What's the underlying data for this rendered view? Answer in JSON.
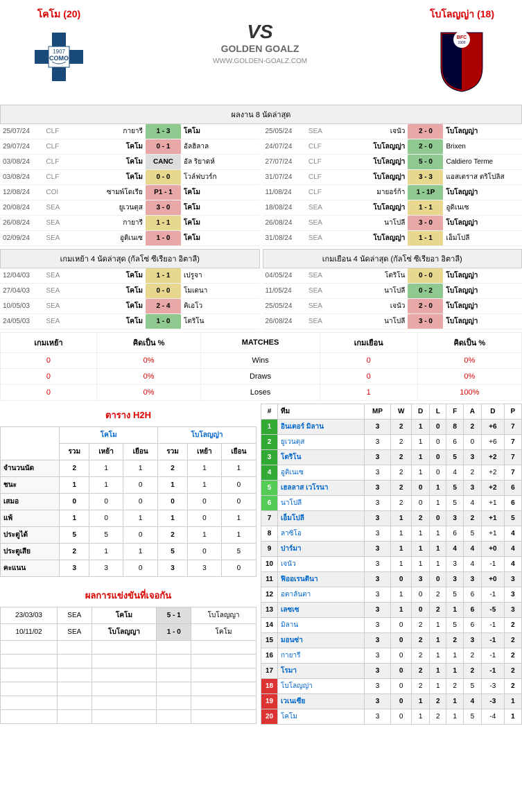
{
  "header": {
    "home": "โคโม (20)",
    "away": "โบโลญญ่า (18)",
    "vs": "VS",
    "site": "GOLDEN GOALZ",
    "site_sub": "WWW.GOLDEN-GOALZ.COM"
  },
  "last8_title": "ผลงาน 8 นัดล่าสุด",
  "last8_home": [
    {
      "date": "25/07/24",
      "comp": "CLF",
      "h": "กายารี",
      "s": "1 - 3",
      "a": "โคโม",
      "c": "sc-green",
      "hb": false,
      "ab": true
    },
    {
      "date": "29/07/24",
      "comp": "CLF",
      "h": "โคโม",
      "s": "0 - 1",
      "a": "อัลฮิลาล",
      "c": "sc-red",
      "hb": true,
      "ab": false
    },
    {
      "date": "03/08/24",
      "comp": "CLF",
      "h": "โคโม",
      "s": "CANC",
      "a": "อัล ริยาดห์",
      "c": "sc-gray",
      "hb": true,
      "ab": false
    },
    {
      "date": "03/08/24",
      "comp": "CLF",
      "h": "โคโม",
      "s": "0 - 0",
      "a": "โวล์ฟบวร์ก",
      "c": "sc-yellow",
      "hb": true,
      "ab": false
    },
    {
      "date": "12/08/24",
      "comp": "COI",
      "h": "ซามพ์โดเรีย",
      "s": "P1 - 1",
      "a": "โคโม",
      "c": "sc-red",
      "hb": false,
      "ab": true
    },
    {
      "date": "20/08/24",
      "comp": "SEA",
      "h": "ยูเวนตุส",
      "s": "3 - 0",
      "a": "โคโม",
      "c": "sc-red",
      "hb": false,
      "ab": true
    },
    {
      "date": "26/08/24",
      "comp": "SEA",
      "h": "กายารี",
      "s": "1 - 1",
      "a": "โคโม",
      "c": "sc-yellow",
      "hb": false,
      "ab": true
    },
    {
      "date": "02/09/24",
      "comp": "SEA",
      "h": "อูดิเนเซ",
      "s": "1 - 0",
      "a": "โคโม",
      "c": "sc-red",
      "hb": false,
      "ab": true
    }
  ],
  "last8_away": [
    {
      "date": "25/05/24",
      "comp": "SEA",
      "h": "เจนัว",
      "s": "2 - 0",
      "a": "โบโลญญ่า",
      "c": "sc-red",
      "hb": false,
      "ab": true
    },
    {
      "date": "24/07/24",
      "comp": "CLF",
      "h": "โบโลญญ่า",
      "s": "2 - 0",
      "a": "Brixen",
      "c": "sc-green",
      "hb": true,
      "ab": false
    },
    {
      "date": "27/07/24",
      "comp": "CLF",
      "h": "โบโลญญ่า",
      "s": "5 - 0",
      "a": "Caldiero Terme",
      "c": "sc-green",
      "hb": true,
      "ab": false
    },
    {
      "date": "31/07/24",
      "comp": "CLF",
      "h": "โบโลญญ่า",
      "s": "3 - 3",
      "a": "แอสเตราส ตริโปลิส",
      "c": "sc-yellow",
      "hb": true,
      "ab": false
    },
    {
      "date": "11/08/24",
      "comp": "CLF",
      "h": "มายอร์ก้า",
      "s": "1 - 1P",
      "a": "โบโลญญ่า",
      "c": "sc-green",
      "hb": false,
      "ab": true
    },
    {
      "date": "18/08/24",
      "comp": "SEA",
      "h": "โบโลญญ่า",
      "s": "1 - 1",
      "a": "อูดิเนเซ",
      "c": "sc-yellow",
      "hb": true,
      "ab": false
    },
    {
      "date": "26/08/24",
      "comp": "SEA",
      "h": "นาโปลี",
      "s": "3 - 0",
      "a": "โบโลญญ่า",
      "c": "sc-red",
      "hb": false,
      "ab": true
    },
    {
      "date": "31/08/24",
      "comp": "SEA",
      "h": "โบโลญญ่า",
      "s": "1 - 1",
      "a": "เอ็มโปลี",
      "c": "sc-yellow",
      "hb": true,
      "ab": false
    }
  ],
  "home4_title": "เกมเหย้า 4 นัดล่าสุด (กัลโซ่ ซีเรียอา อิตาลี)",
  "away4_title": "เกมเยือน 4 นัดล่าสุด (กัลโซ่ ซีเรียอา อิตาลี)",
  "home4": [
    {
      "date": "12/04/03",
      "comp": "SEA",
      "h": "โคโม",
      "s": "1 - 1",
      "a": "เปรูจา",
      "c": "sc-yellow",
      "hb": true,
      "ab": false
    },
    {
      "date": "27/04/03",
      "comp": "SEA",
      "h": "โคโม",
      "s": "0 - 0",
      "a": "โมเดนา",
      "c": "sc-yellow",
      "hb": true,
      "ab": false
    },
    {
      "date": "10/05/03",
      "comp": "SEA",
      "h": "โคโม",
      "s": "2 - 4",
      "a": "คิเอโว",
      "c": "sc-red",
      "hb": true,
      "ab": false
    },
    {
      "date": "24/05/03",
      "comp": "SEA",
      "h": "โคโม",
      "s": "1 - 0",
      "a": "โตริโน",
      "c": "sc-green",
      "hb": true,
      "ab": false
    }
  ],
  "away4": [
    {
      "date": "04/05/24",
      "comp": "SEA",
      "h": "โตริโน",
      "s": "0 - 0",
      "a": "โบโลญญ่า",
      "c": "sc-yellow",
      "hb": false,
      "ab": true
    },
    {
      "date": "11/05/24",
      "comp": "SEA",
      "h": "นาโปลี",
      "s": "0 - 2",
      "a": "โบโลญญ่า",
      "c": "sc-green",
      "hb": false,
      "ab": true
    },
    {
      "date": "25/05/24",
      "comp": "SEA",
      "h": "เจนัว",
      "s": "2 - 0",
      "a": "โบโลญญ่า",
      "c": "sc-red",
      "hb": false,
      "ab": true
    },
    {
      "date": "26/08/24",
      "comp": "SEA",
      "h": "นาโปลี",
      "s": "3 - 0",
      "a": "โบโลญญ่า",
      "c": "sc-red",
      "hb": false,
      "ab": true
    }
  ],
  "summary": {
    "headers": [
      "เกมเหย้า",
      "คิดเป็น %",
      "MATCHES",
      "เกมเยือน",
      "คิดเป็น %"
    ],
    "rows": [
      [
        "0",
        "0%",
        "Wins",
        "0",
        "0%"
      ],
      [
        "0",
        "0%",
        "Draws",
        "0",
        "0%"
      ],
      [
        "0",
        "0%",
        "Loses",
        "1",
        "100%"
      ]
    ]
  },
  "h2h": {
    "title": "ตาราง H2H",
    "teams": [
      "โคโม",
      "โบโลญญ่า"
    ],
    "cols": [
      "รวม",
      "เหย้า",
      "เยือน",
      "รวม",
      "เหย้า",
      "เยือน"
    ],
    "rows": [
      {
        "lbl": "จำนวนนัด",
        "v": [
          "2",
          "1",
          "1",
          "2",
          "1",
          "1"
        ],
        "b": [
          0,
          3
        ]
      },
      {
        "lbl": "ชนะ",
        "v": [
          "1",
          "1",
          "0",
          "1",
          "1",
          "0"
        ],
        "b": [
          0,
          3
        ]
      },
      {
        "lbl": "เสมอ",
        "v": [
          "0",
          "0",
          "0",
          "0",
          "0",
          "0"
        ],
        "b": [
          0,
          3
        ]
      },
      {
        "lbl": "แพ้",
        "v": [
          "1",
          "0",
          "1",
          "1",
          "0",
          "1"
        ],
        "b": [
          0,
          3
        ]
      },
      {
        "lbl": "ประตูได้",
        "v": [
          "5",
          "5",
          "0",
          "2",
          "1",
          "1"
        ],
        "b": [
          0,
          3
        ]
      },
      {
        "lbl": "ประตูเสีย",
        "v": [
          "2",
          "1",
          "1",
          "5",
          "0",
          "5"
        ],
        "b": [
          0,
          3
        ]
      },
      {
        "lbl": "คะแนน",
        "v": [
          "3",
          "3",
          "0",
          "3",
          "3",
          "0"
        ],
        "b": [
          0,
          3
        ]
      }
    ]
  },
  "meetings": {
    "title": "ผลการแข่งขันที่เจอกัน",
    "rows": [
      {
        "date": "23/03/03",
        "comp": "SEA",
        "h": "โคโม",
        "s": "5 - 1",
        "a": "โบโลญญา",
        "c": "sc-gray",
        "hb": true,
        "ab": false
      },
      {
        "date": "10/11/02",
        "comp": "SEA",
        "h": "โบโลญญา",
        "s": "1 - 0",
        "a": "โคโม",
        "c": "sc-gray",
        "hb": true,
        "ab": false
      }
    ],
    "empty_rows": 6
  },
  "standings": {
    "headers": [
      "#",
      "ทีม",
      "MP",
      "W",
      "D",
      "L",
      "F",
      "A",
      "D",
      "P"
    ],
    "rows": [
      {
        "r": 1,
        "t": "อินเตอร์ มิลาน",
        "v": [
          3,
          2,
          1,
          0,
          8,
          2,
          "+6",
          7
        ],
        "rk": "rk-green",
        "hl": true
      },
      {
        "r": 2,
        "t": "ยูเวนตุส",
        "v": [
          3,
          2,
          1,
          0,
          6,
          0,
          "+6",
          7
        ],
        "rk": "rk-green"
      },
      {
        "r": 3,
        "t": "โตริโน",
        "v": [
          3,
          2,
          1,
          0,
          5,
          3,
          "+2",
          7
        ],
        "rk": "rk-green",
        "hl": true
      },
      {
        "r": 4,
        "t": "อูดิเนเซ",
        "v": [
          3,
          2,
          1,
          0,
          4,
          2,
          "+2",
          7
        ],
        "rk": "rk-green"
      },
      {
        "r": 5,
        "t": "เฮลลาส เวโรนา",
        "v": [
          3,
          2,
          0,
          1,
          5,
          3,
          "+2",
          6
        ],
        "rk": "rk-lgreen",
        "hl": true
      },
      {
        "r": 6,
        "t": "นาโปลี",
        "v": [
          3,
          2,
          0,
          1,
          5,
          4,
          "+1",
          6
        ],
        "rk": "rk-lgreen"
      },
      {
        "r": 7,
        "t": "เอ็มโปลี",
        "v": [
          3,
          1,
          2,
          0,
          3,
          2,
          "+1",
          5
        ],
        "rk": "",
        "hl": true
      },
      {
        "r": 8,
        "t": "ลาซิโอ",
        "v": [
          3,
          1,
          1,
          1,
          6,
          5,
          "+1",
          4
        ],
        "rk": ""
      },
      {
        "r": 9,
        "t": "ปาร์มา",
        "v": [
          3,
          1,
          1,
          1,
          4,
          4,
          "+0",
          4
        ],
        "rk": "",
        "hl": true
      },
      {
        "r": 10,
        "t": "เจนัว",
        "v": [
          3,
          1,
          1,
          1,
          3,
          4,
          "-1",
          4
        ],
        "rk": ""
      },
      {
        "r": 11,
        "t": "ฟิออเรนตินา",
        "v": [
          3,
          0,
          3,
          0,
          3,
          3,
          "+0",
          3
        ],
        "rk": "",
        "hl": true
      },
      {
        "r": 12,
        "t": "อตาลันตา",
        "v": [
          3,
          1,
          0,
          2,
          5,
          6,
          "-1",
          3
        ],
        "rk": ""
      },
      {
        "r": 13,
        "t": "เลซเซ",
        "v": [
          3,
          1,
          0,
          2,
          1,
          6,
          "-5",
          3
        ],
        "rk": "",
        "hl": true
      },
      {
        "r": 14,
        "t": "มิลาน",
        "v": [
          3,
          0,
          2,
          1,
          5,
          6,
          "-1",
          2
        ],
        "rk": ""
      },
      {
        "r": 15,
        "t": "มอนซ่า",
        "v": [
          3,
          0,
          2,
          1,
          2,
          3,
          "-1",
          2
        ],
        "rk": "",
        "hl": true
      },
      {
        "r": 16,
        "t": "กายารี",
        "v": [
          3,
          0,
          2,
          1,
          1,
          2,
          "-1",
          2
        ],
        "rk": ""
      },
      {
        "r": 17,
        "t": "โรมา",
        "v": [
          3,
          0,
          2,
          1,
          1,
          2,
          "-1",
          2
        ],
        "rk": "",
        "hl": true
      },
      {
        "r": 18,
        "t": "โบโลญญ่า",
        "v": [
          3,
          0,
          2,
          1,
          2,
          5,
          "-3",
          2
        ],
        "rk": "rk-red"
      },
      {
        "r": 19,
        "t": "เวเนเซีย",
        "v": [
          3,
          0,
          1,
          2,
          1,
          4,
          "-3",
          1
        ],
        "rk": "rk-red",
        "hl": true
      },
      {
        "r": 20,
        "t": "โคโม",
        "v": [
          3,
          0,
          1,
          2,
          1,
          5,
          "-4",
          1
        ],
        "rk": "rk-red"
      }
    ]
  }
}
